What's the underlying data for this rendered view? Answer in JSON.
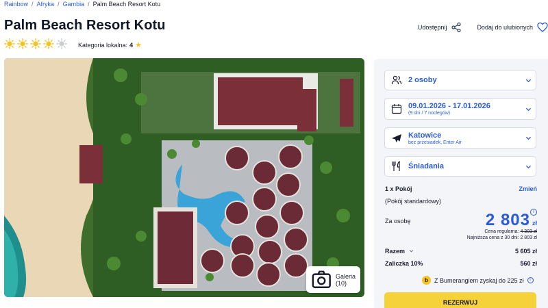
{
  "breadcrumb": {
    "items": [
      "Rainbow",
      "Afryka",
      "Gambia"
    ],
    "current": "Palm Beach Resort Kotu",
    "separator": "/"
  },
  "hotel": {
    "name": "Palm Beach Resort Kotu",
    "sun_rating": 4,
    "sun_max": 5,
    "local_category_label": "Kategoria lokalna:",
    "local_category_value": "4"
  },
  "actions": {
    "share_label": "Udostępnij",
    "favorite_label": "Dodaj do ulubionych"
  },
  "gallery": {
    "button_label": "Galeria (10)"
  },
  "booking": {
    "persons": "2 osoby",
    "dates": "09.01.2026 - 17.01.2026",
    "dates_sub": "(9 dni / 7 noclegów)",
    "departure": "Katowice",
    "departure_sub": "bez przesiadek, Enter Air",
    "board": "Śniadania",
    "room_count": "1 x Pokój",
    "room_change": "Zmień",
    "room_type": "(Pokój standardowy)",
    "per_person_label": "Za osobę",
    "price": "2 803",
    "currency": "zł",
    "regular_price_label": "Cena regularna:",
    "regular_price": "4 303 zł",
    "lowest_price_label": "Najniższa cena z 30 dni:",
    "lowest_price": "2 803 zł",
    "total_label": "Razem",
    "total_value": "5 605 zł",
    "deposit_label": "Zaliczka 10%",
    "deposit_value": "560 zł",
    "boomerang_text": "Z Bumerangiem zyskaj do 225 zł",
    "reserve_label": "REZERWUJ"
  },
  "colors": {
    "accent": "#2a5bd7",
    "reserve_button": "#f6d23a",
    "sun": "#f6c324",
    "panel_bg": "#f3f5f8"
  }
}
